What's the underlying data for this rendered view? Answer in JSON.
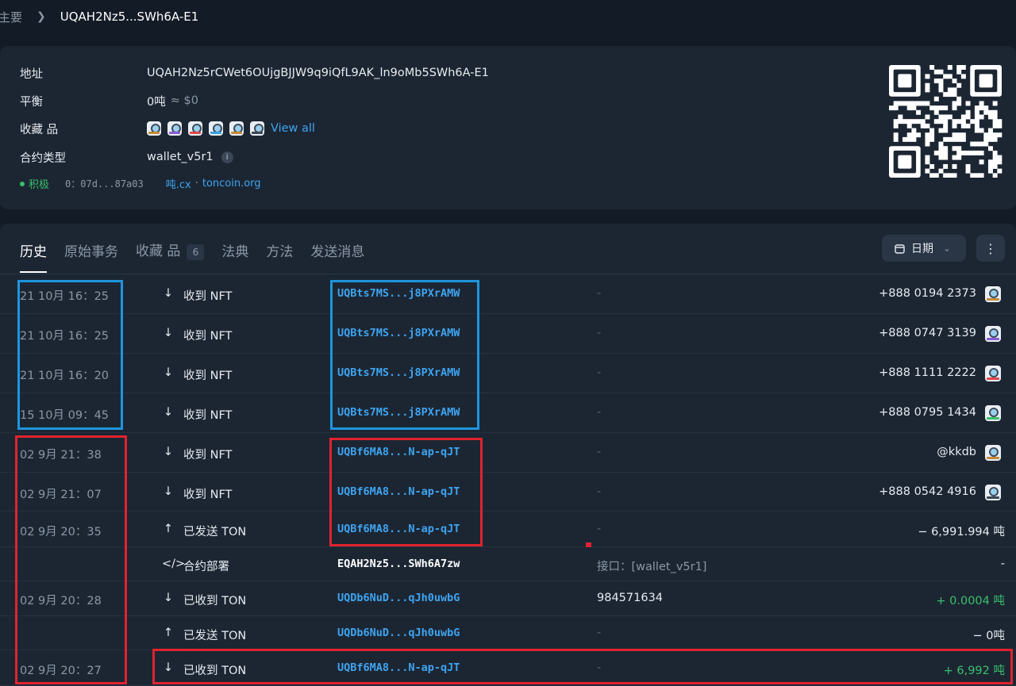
{
  "breadcrumb": {
    "home": "主要",
    "current": "UQAH2Nz5...SWh6A-E1"
  },
  "info": {
    "address_label": "地址",
    "address": "UQAH2Nz5rCWet6OUjgBJJW9q9iQfL9AK_ln9oMb5SWh6A-E1",
    "balance_label": "平衡",
    "balance_value": "0吨",
    "balance_usd": "≈ $0",
    "collectibles_label": "收藏 品",
    "view_all": "View all",
    "contract_type_label": "合约类型",
    "contract_type": "wallet_v5r1",
    "status": "积极",
    "code_hash": "0：07d...87a03",
    "link_tonscan": "吨.cx",
    "link_sep": "·",
    "link_toncoin": "toncoin.org"
  },
  "nft_colors": [
    "#c48a3a",
    "#8a5bd6",
    "#e04848",
    "#3aa0e0",
    "#c48a3a",
    "#3b4756"
  ],
  "tabs": {
    "history": "历史",
    "raw_tx": "原始事务",
    "collectibles": "收藏 品",
    "collectibles_count": "6",
    "code": "法典",
    "methods": "方法",
    "send_message": "发送消息",
    "date_button": "日期",
    "more": "⋮"
  },
  "transactions": [
    {
      "date": "21 10月 16：25",
      "dir": "↓",
      "type": "收到 NFT",
      "addr": "UQBts7MS...j8PXrAMW",
      "mid": "-",
      "amount": "+888 0194 2373",
      "thumb_bar": "#c48a3a"
    },
    {
      "date": "21 10月 16：25",
      "dir": "↓",
      "type": "收到 NFT",
      "addr": "UQBts7MS...j8PXrAMW",
      "mid": "-",
      "amount": "+888 0747 3139",
      "thumb_bar": "#8a5bd6"
    },
    {
      "date": "21 10月 16：20",
      "dir": "↓",
      "type": "收到 NFT",
      "addr": "UQBts7MS...j8PXrAMW",
      "mid": "-",
      "amount": "+888 1111 2222",
      "thumb_bar": "#e04848"
    },
    {
      "date": "15 10月 09：45",
      "dir": "↓",
      "type": "收到 NFT",
      "addr": "UQBts7MS...j8PXrAMW",
      "mid": "-",
      "amount": "+888 0795 1434",
      "thumb_bar": "#39c06a"
    },
    {
      "date": "02 9月 21：38",
      "dir": "↓",
      "type": "收到 NFT",
      "addr": "UQBf6MA8...N-ap-qJT",
      "mid": "-",
      "amount": "@kkdb",
      "thumb_bar": "#c48a3a"
    },
    {
      "date": "02 9月 21：07",
      "dir": "↓",
      "type": "收到 NFT",
      "addr": "UQBf6MA8...N-ap-qJT",
      "mid": "-",
      "amount": "+888 0542 4916",
      "thumb_bar": "#3b4756"
    },
    {
      "date": "02 9月 20：35",
      "dir": "↑",
      "type": "已发送 TON",
      "addr": "UQBf6MA8...N-ap-qJT",
      "mid": "-",
      "amount": "− 6,991.994 吨"
    },
    {
      "date": "",
      "dir": "</>",
      "type": "合约部署",
      "addr": "EQAH2Nz5...SWh6A7zw",
      "mid": "接口：[wallet_v5r1]",
      "amount": "-"
    },
    {
      "date": "02 9月 20：28",
      "dir": "↓",
      "type": "已收到 TON",
      "addr": "UQDb6NuD...qJh0uwbG",
      "mid": "984571634",
      "amount": "+ 0.0004 吨"
    },
    {
      "date": "",
      "dir": "↑",
      "type": "已发送 TON",
      "addr": "UQDb6NuD...qJh0uwbG",
      "mid": "-",
      "amount": "− 0吨"
    },
    {
      "date": "02 9月 20：27",
      "dir": "↓",
      "type": "已收到 TON",
      "addr": "UQBf6MA8...N-ap-qJT",
      "mid": "-",
      "amount": "+ 6,992 吨"
    }
  ]
}
